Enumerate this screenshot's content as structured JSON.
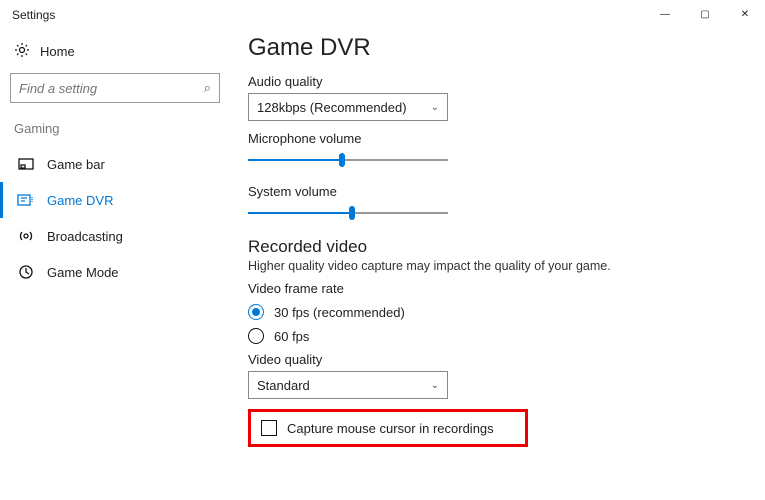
{
  "window": {
    "title": "Settings"
  },
  "sidebar": {
    "home_label": "Home",
    "search_placeholder": "Find a setting",
    "category": "Gaming",
    "items": [
      {
        "label": "Game bar",
        "icon": "gamebar-icon"
      },
      {
        "label": "Game DVR",
        "icon": "dvr-icon"
      },
      {
        "label": "Broadcasting",
        "icon": "broadcast-icon"
      },
      {
        "label": "Game Mode",
        "icon": "gamemode-icon"
      }
    ],
    "active_index": 1
  },
  "main": {
    "title": "Game DVR",
    "audio_quality_label": "Audio quality",
    "audio_quality_value": "128kbps (Recommended)",
    "mic_volume_label": "Microphone volume",
    "mic_volume_percent": 47,
    "sys_volume_label": "System volume",
    "sys_volume_percent": 52,
    "recorded_heading": "Recorded video",
    "recorded_desc": "Higher quality video capture may impact the quality of your game.",
    "framerate_label": "Video frame rate",
    "framerate_options": [
      {
        "label": "30 fps (recommended)",
        "checked": true
      },
      {
        "label": "60 fps",
        "checked": false
      }
    ],
    "video_quality_label": "Video quality",
    "video_quality_value": "Standard",
    "capture_cursor_label": "Capture mouse cursor in recordings",
    "capture_cursor_checked": false
  }
}
